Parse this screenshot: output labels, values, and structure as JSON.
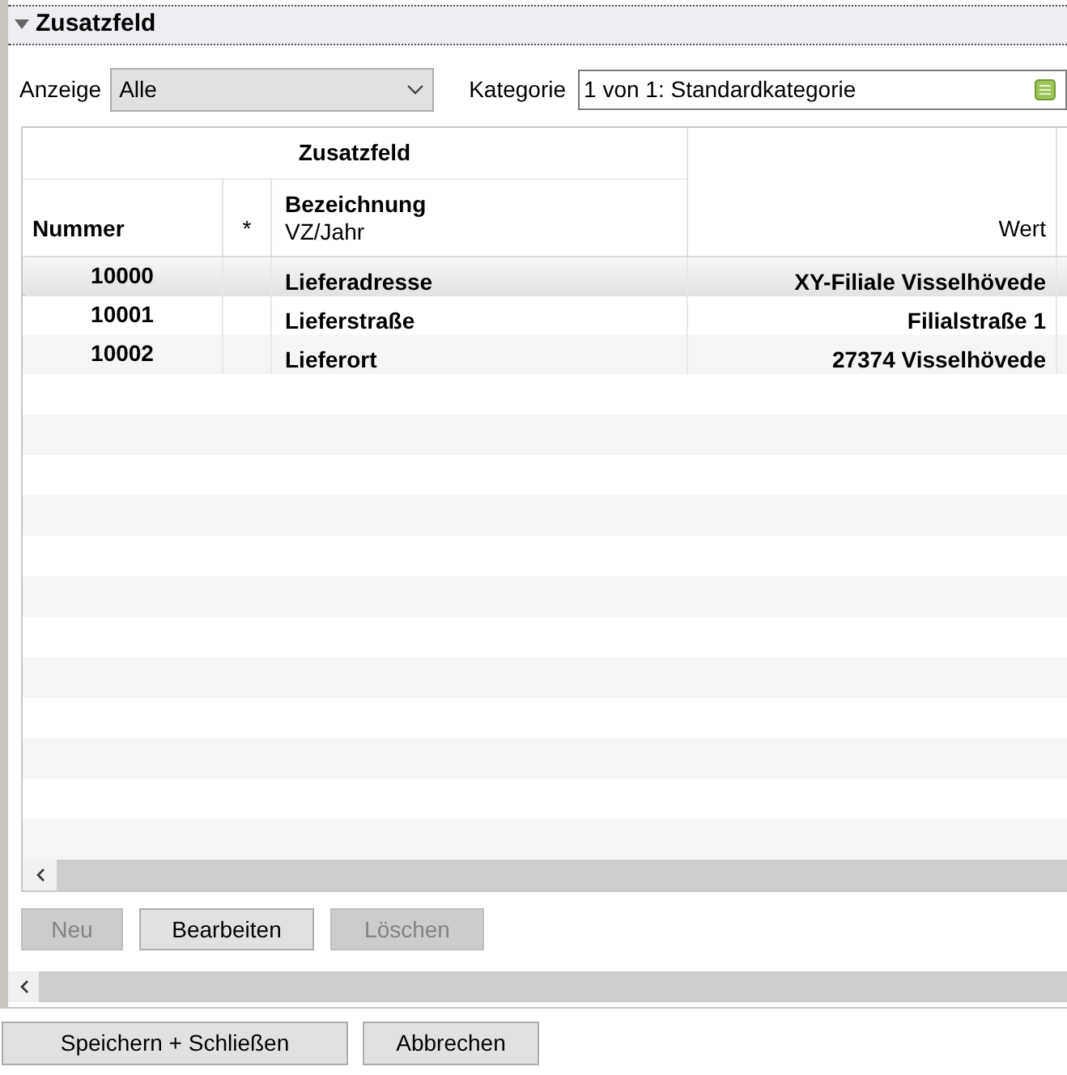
{
  "section": {
    "title": "Zusatzfeld",
    "expanded": true
  },
  "filters": {
    "anzeige": {
      "label": "Anzeige",
      "value": "Alle"
    },
    "kategorie": {
      "label": "Kategorie",
      "value": "1 von 1: Standardkategorie"
    }
  },
  "table": {
    "group_header": "Zusatzfeld",
    "columns": [
      {
        "label": "Nummer"
      },
      {
        "label": "*"
      },
      {
        "label": "Bezeichnung",
        "sublabel": "VZ/Jahr"
      },
      {
        "label": "Wert"
      }
    ],
    "rows": [
      {
        "nummer": "10000",
        "bezeichnung": "Lieferadresse",
        "wert": "XY-Filiale Visselhövede",
        "selected": true
      },
      {
        "nummer": "10001",
        "bezeichnung": "Lieferstraße",
        "wert": "Filialstraße 1",
        "selected": false
      },
      {
        "nummer": "10002",
        "bezeichnung": "Lieferort",
        "wert": "27374 Visselhövede",
        "selected": false
      }
    ]
  },
  "table_buttons": [
    {
      "label": "Neu",
      "disabled": true
    },
    {
      "label": "Bearbeiten",
      "disabled": false
    },
    {
      "label": "Löschen",
      "disabled": true
    }
  ],
  "footer_buttons": [
    {
      "label": "Speichern + Schließen"
    },
    {
      "label": "Abbrechen"
    }
  ]
}
